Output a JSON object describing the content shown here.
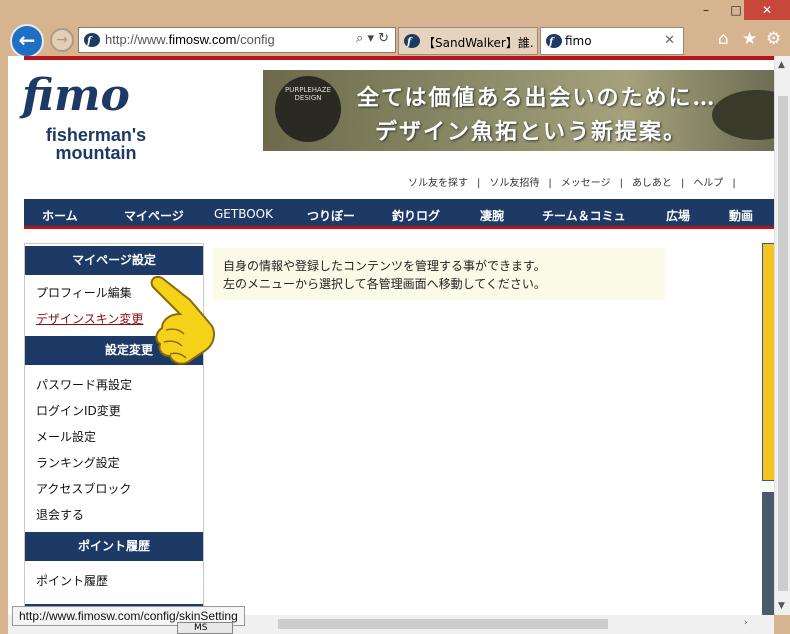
{
  "window": {
    "minimize": "–",
    "maximize": "□",
    "close": "✕"
  },
  "toolbar": {
    "back_icon": "←",
    "forward_icon": "→",
    "url_prefix": "http://www.",
    "url_domain": "fimosw.com",
    "url_path": "/config",
    "url_tools": "⌕ ▾ ↻",
    "tabs": [
      {
        "label": "【SandWalker】誰...",
        "active": false
      },
      {
        "label": "fimo",
        "active": true,
        "close": "✕"
      }
    ],
    "home_icon": "⌂",
    "favorites_icon": "★",
    "settings_icon": "⚙"
  },
  "site": {
    "logo_word": "fimo",
    "logo_line1": "fisherman's",
    "logo_line2": "mountain",
    "banner_line1": "全ては価値ある出会いのために…",
    "banner_line2": "デザイン魚拓という新提案。",
    "banner_seal": "PURPLEHAZE DESIGN"
  },
  "util_links": [
    "ソル友を探す",
    "ソル友招待",
    "メッセージ",
    "あしあと",
    "ヘルプ"
  ],
  "util_sep": "|",
  "gnav": [
    "ホーム",
    "マイページ",
    "GETBOOK",
    "つりぼー",
    "釣りログ",
    "凄腕",
    "チーム＆コミュ",
    "広場",
    "動画"
  ],
  "sidebar": {
    "sections": [
      {
        "title": "マイページ設定",
        "items": [
          "プロフィール編集",
          "デザインスキン変更"
        ]
      },
      {
        "title": "設定変更",
        "items": [
          "パスワード再設定",
          "ログインID変更",
          "メール設定",
          "ランキング設定",
          "アクセスブロック",
          "退会する"
        ]
      },
      {
        "title": "ポイント履歴",
        "items": [
          "ポイント履歴"
        ]
      }
    ]
  },
  "info": {
    "line1": "自身の情報や登録したコンテンツを管理する事ができます。",
    "line2": "左のメニューから選択して各管理画面へ移動してください。"
  },
  "status": {
    "url": "http://www.fimosw.com/config/skinSetting",
    "task_label": "MS"
  },
  "colors": {
    "navy": "#1d3966",
    "accent_red": "#b8151b",
    "frame": "#d6b48f"
  }
}
